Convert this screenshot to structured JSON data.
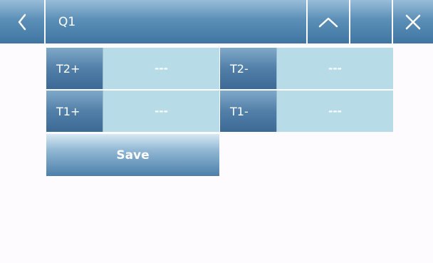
{
  "header": {
    "title": "Q1",
    "back_icon": "chevron-left-icon",
    "up_icon": "chevron-up-icon",
    "close_icon": "close-icon"
  },
  "thresholds": {
    "row1": {
      "left_label": "T2+",
      "left_value": "---",
      "right_label": "T2-",
      "right_value": "---"
    },
    "row2": {
      "left_label": "T1+",
      "left_value": "---",
      "right_label": "T1-",
      "right_value": "---"
    }
  },
  "actions": {
    "save_label": "Save"
  },
  "colors": {
    "header_blue": "#3f76a1",
    "value_cell": "#b8dbe8",
    "background": "#fdfbfd"
  }
}
